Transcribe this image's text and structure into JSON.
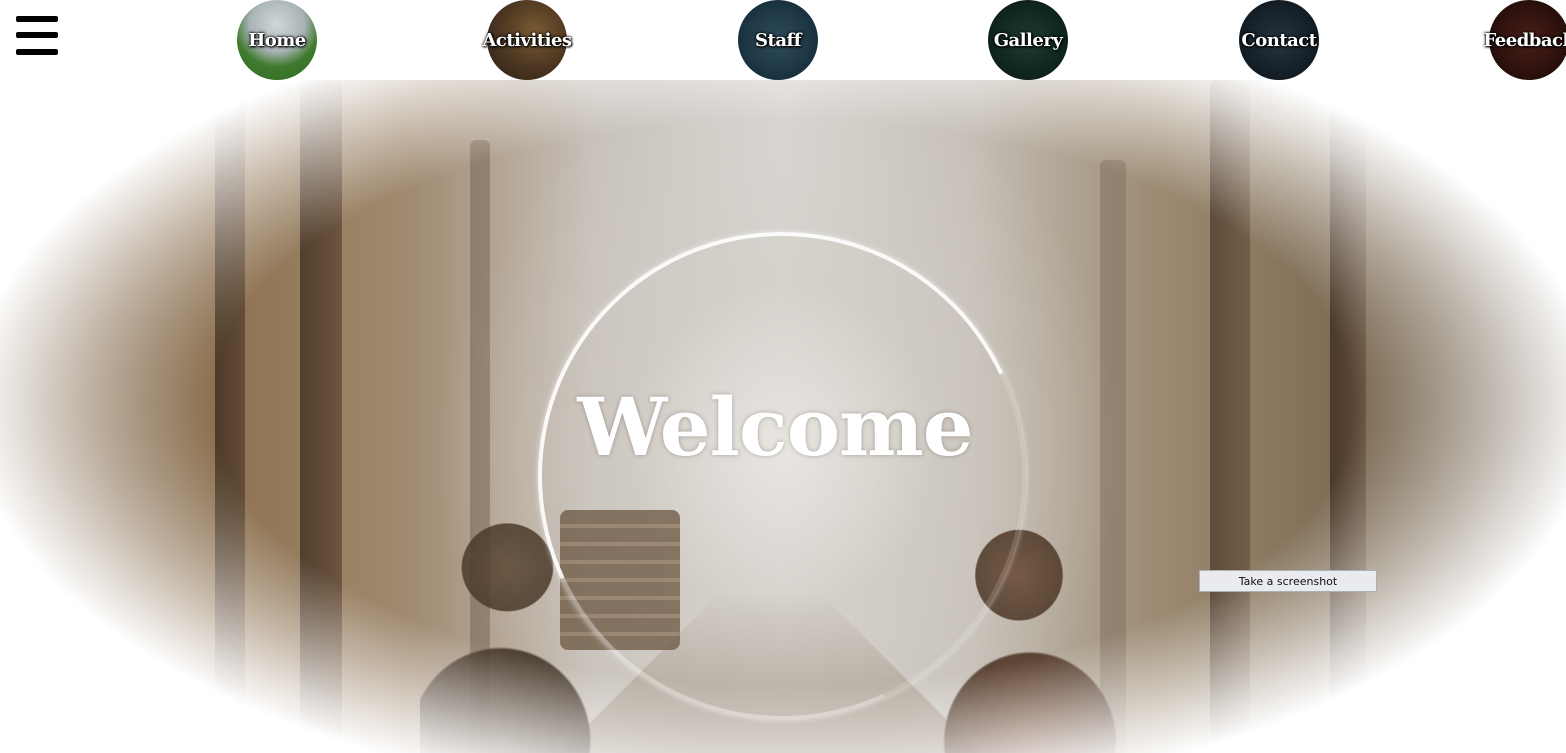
{
  "nav": {
    "menu_icon": "hamburger-menu-icon",
    "items": [
      {
        "label": "Home"
      },
      {
        "label": "Activities"
      },
      {
        "label": "Staff"
      },
      {
        "label": "Gallery"
      },
      {
        "label": "Contact"
      },
      {
        "label": "Feedback"
      }
    ]
  },
  "hero": {
    "title": "Welcome",
    "logo_icon": "mountain-logo-icon"
  },
  "overlay": {
    "screenshot_button": "Take a screenshot"
  },
  "colors": {
    "nav_background": "#ffffff",
    "nav_text": "#ffffff",
    "hero_title": "#ffffff",
    "menu_icon": "#000000"
  }
}
